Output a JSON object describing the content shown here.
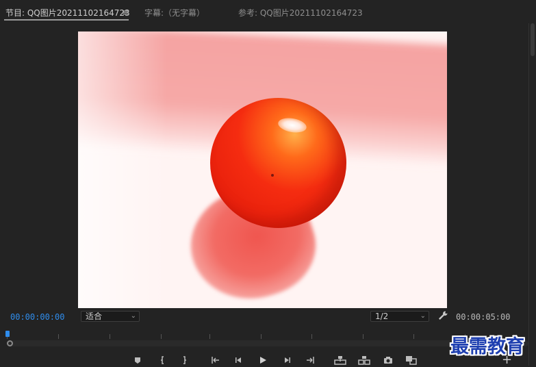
{
  "tabs": [
    {
      "label": "节目: QQ图片20211102164723",
      "active": true
    },
    {
      "label": "字幕:（无字幕）",
      "active": false
    },
    {
      "label": "参考: QQ图片20211102164723",
      "active": false
    }
  ],
  "menu_icon": "hamburger-menu-icon",
  "timecodes": {
    "current": "00:00:00:00",
    "duration": "00:00:05:00"
  },
  "zoom_select": {
    "value": "适合"
  },
  "resolution_select": {
    "value": "1/2"
  },
  "watermark": "最需教育",
  "transport_buttons": [
    "add-marker-icon",
    "mark-in-icon",
    "mark-out-icon",
    "go-to-in-icon",
    "step-back-icon",
    "play-icon",
    "step-forward-icon",
    "go-to-out-icon",
    "lift-icon",
    "extract-icon",
    "export-frame-icon",
    "comparison-view-icon",
    "add-button-icon"
  ],
  "colors": {
    "accent_blue": "#2f8ded",
    "panel_bg": "#232323"
  }
}
